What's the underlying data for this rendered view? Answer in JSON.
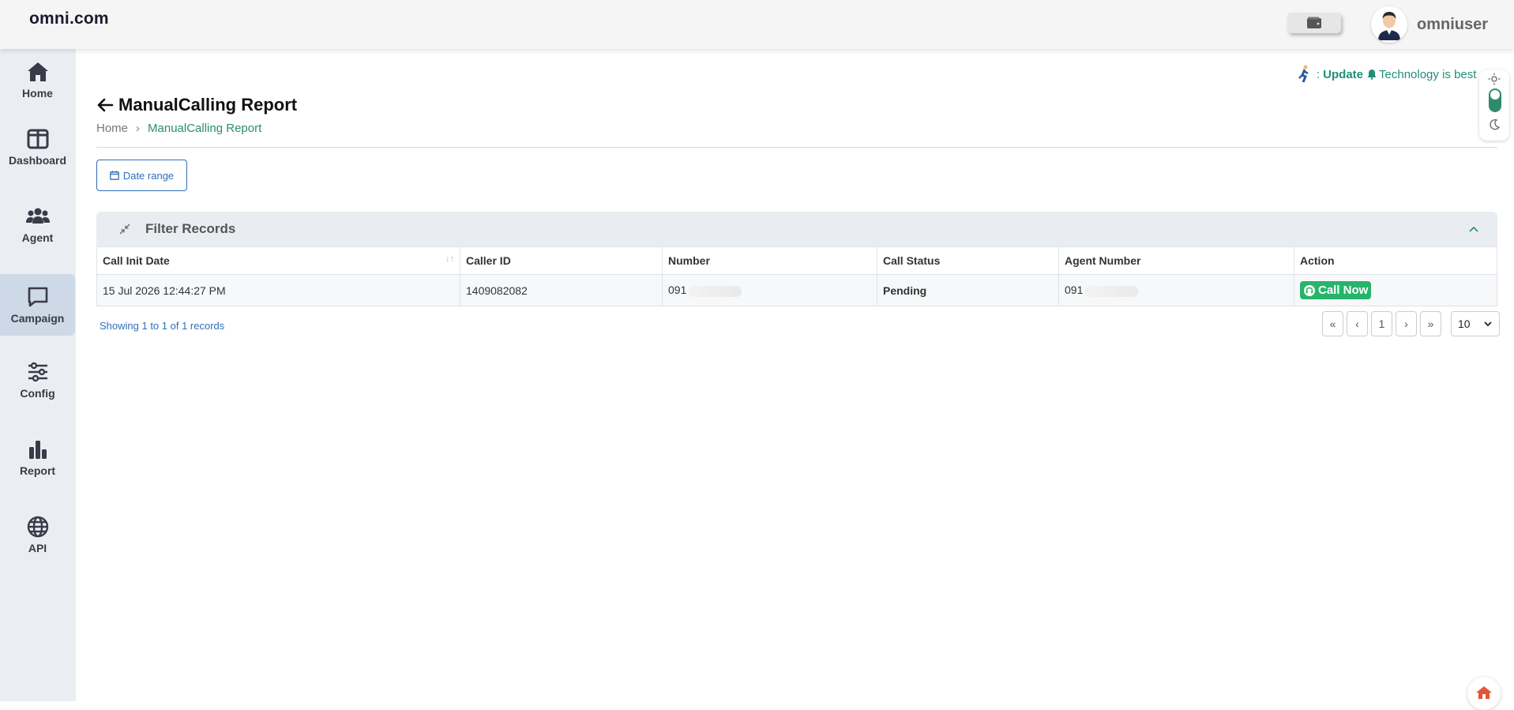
{
  "header": {
    "brand": "omni.com",
    "username": "omniuser",
    "wallet_icon": "wallet-icon",
    "avatar_icon": "user-avatar"
  },
  "sidebar": {
    "items": [
      {
        "label": "Home",
        "icon": "home-icon"
      },
      {
        "label": "Dashboard",
        "icon": "dashboard-icon"
      },
      {
        "label": "Agent",
        "icon": "users-icon"
      },
      {
        "label": "Campaign",
        "icon": "chat-icon",
        "active": true
      },
      {
        "label": "Config",
        "icon": "sliders-icon"
      },
      {
        "label": "Report",
        "icon": "bar-chart-icon"
      },
      {
        "label": "API",
        "icon": "globe-icon"
      }
    ]
  },
  "ticker": {
    "prefix": ":",
    "update": "Update",
    "text": "Technology is best"
  },
  "page": {
    "title": "ManualCalling Report",
    "breadcrumb": {
      "home": "Home",
      "separator": "›",
      "current": "ManualCalling Report"
    },
    "date_range_label": "Date range"
  },
  "filter": {
    "title": "Filter Records"
  },
  "table": {
    "columns": [
      "Call Init Date",
      "Caller ID",
      "Number",
      "Call Status",
      "Agent Number",
      "Action"
    ],
    "rows": [
      {
        "call_init_date": "15 Jul 2026 12:44:27 PM",
        "caller_id": "1409082082",
        "number": "091",
        "call_status": "Pending",
        "agent_number": "091",
        "action": "Call Now"
      }
    ]
  },
  "pagination": {
    "showing": "Showing 1 to 1 of 1 records",
    "first": "«",
    "prev": "‹",
    "page": "1",
    "next": "›",
    "last": "»",
    "page_size": "10"
  },
  "colors": {
    "accent_green": "#2a8c6d",
    "link_blue": "#2f6fb8",
    "call_button": "#27b46b",
    "sidebar_bg": "#eaeef3"
  }
}
